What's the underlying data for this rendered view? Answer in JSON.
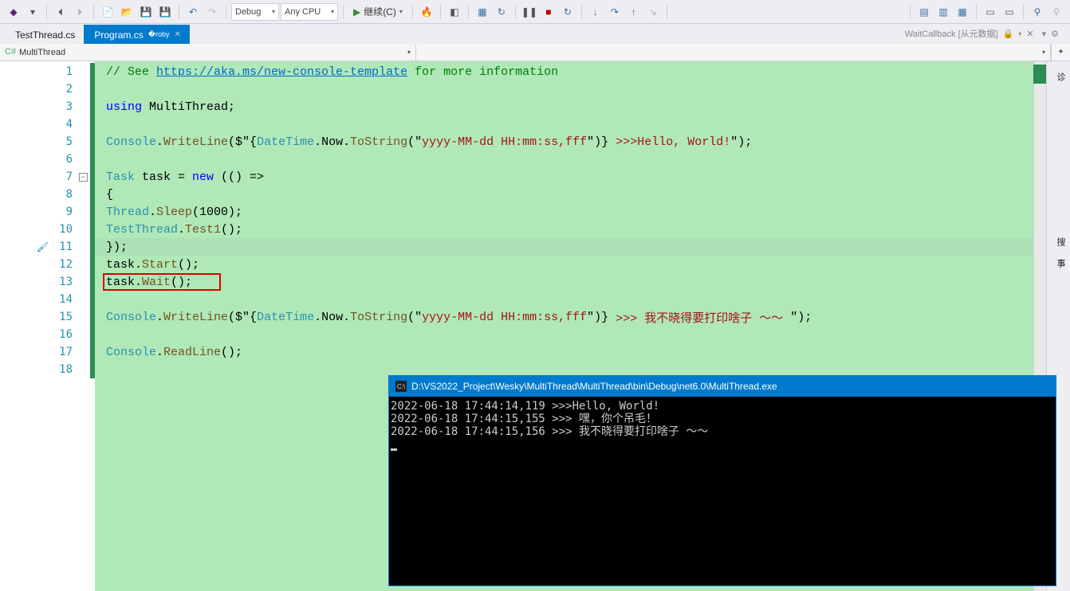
{
  "toolbar": {
    "config": "Debug",
    "platform": "Any CPU",
    "run_label": "继续(C)"
  },
  "tabs": {
    "items": [
      {
        "label": "TestThread.cs",
        "active": false
      },
      {
        "label": "Program.cs",
        "active": true
      }
    ],
    "right_label": "WaitCallback [从元数据]"
  },
  "nav": {
    "scope": "MultiThread"
  },
  "code": {
    "line1_prefix": "// See ",
    "line1_url": "https://aka.ms/new-console-template",
    "line1_suffix": " for more information",
    "line3_using": "using",
    "line3_ns": " MultiThread;",
    "line5_console": "Console",
    "line5_dot_wl": ".",
    "line5_writeline": "WriteLine",
    "line5_open": "($\"{",
    "line5_datetime": "DateTime",
    "line5_now": ".Now.",
    "line5_tostring": "ToString",
    "line5_fmt": "(\"",
    "line5_fmtstr": "yyyy-MM-dd HH:mm:ss,fff",
    "line5_fmtend": "\")} ",
    "line5_msg": ">>>Hello, World!",
    "line5_end": "\");",
    "line7_task": "Task",
    "line7_var": " task = ",
    "line7_new": "new",
    "line7_lambda": " (() =>",
    "line8_brace": "{",
    "line9_thread": "Thread",
    "line9_sleep": ".",
    "line9_sleepm": "Sleep",
    "line9_arg": "(1000);",
    "line10_tt": "TestThread",
    "line10_dot": ".",
    "line10_test1": "Test1",
    "line10_end": "();",
    "line11_close": "});",
    "line12_task": "task.",
    "line12_start": "Start",
    "line12_end": "();",
    "line13_task": "task.",
    "line13_wait": "Wait",
    "line13_end": "();",
    "line15_console": "Console",
    "line15_dot": ".",
    "line15_writeline": "WriteLine",
    "line15_open": "($\"{",
    "line15_datetime": "DateTime",
    "line15_now": ".Now.",
    "line15_tostring": "ToString",
    "line15_fmt": "(\"",
    "line15_fmtstr": "yyyy-MM-dd HH:mm:ss,fff",
    "line15_fmtend": "\")} ",
    "line15_msg": ">>> 我不晓得要打印啥子 ～～ ",
    "line15_end": "\");",
    "line17_console": "Console",
    "line17_dot": ".",
    "line17_readline": "ReadLine",
    "line17_end": "();",
    "lines": [
      "1",
      "2",
      "3",
      "4",
      "5",
      "6",
      "7",
      "8",
      "9",
      "10",
      "11",
      "12",
      "13",
      "14",
      "15",
      "16",
      "17",
      "18"
    ]
  },
  "console": {
    "title": "D:\\VS2022_Project\\Wesky\\MultiThread\\MultiThread\\bin\\Debug\\net6.0\\MultiThread.exe",
    "line1": "2022-06-18 17:44:14,119 >>>Hello, World!",
    "line2": "2022-06-18 17:44:15,155 >>> 嘿，你个吊毛！",
    "line3": "2022-06-18 17:44:15,156 >>> 我不晓得要打印啥子 ～～"
  },
  "side": {
    "tab1": "诊",
    "tab2": "搜",
    "tab3": "事"
  }
}
